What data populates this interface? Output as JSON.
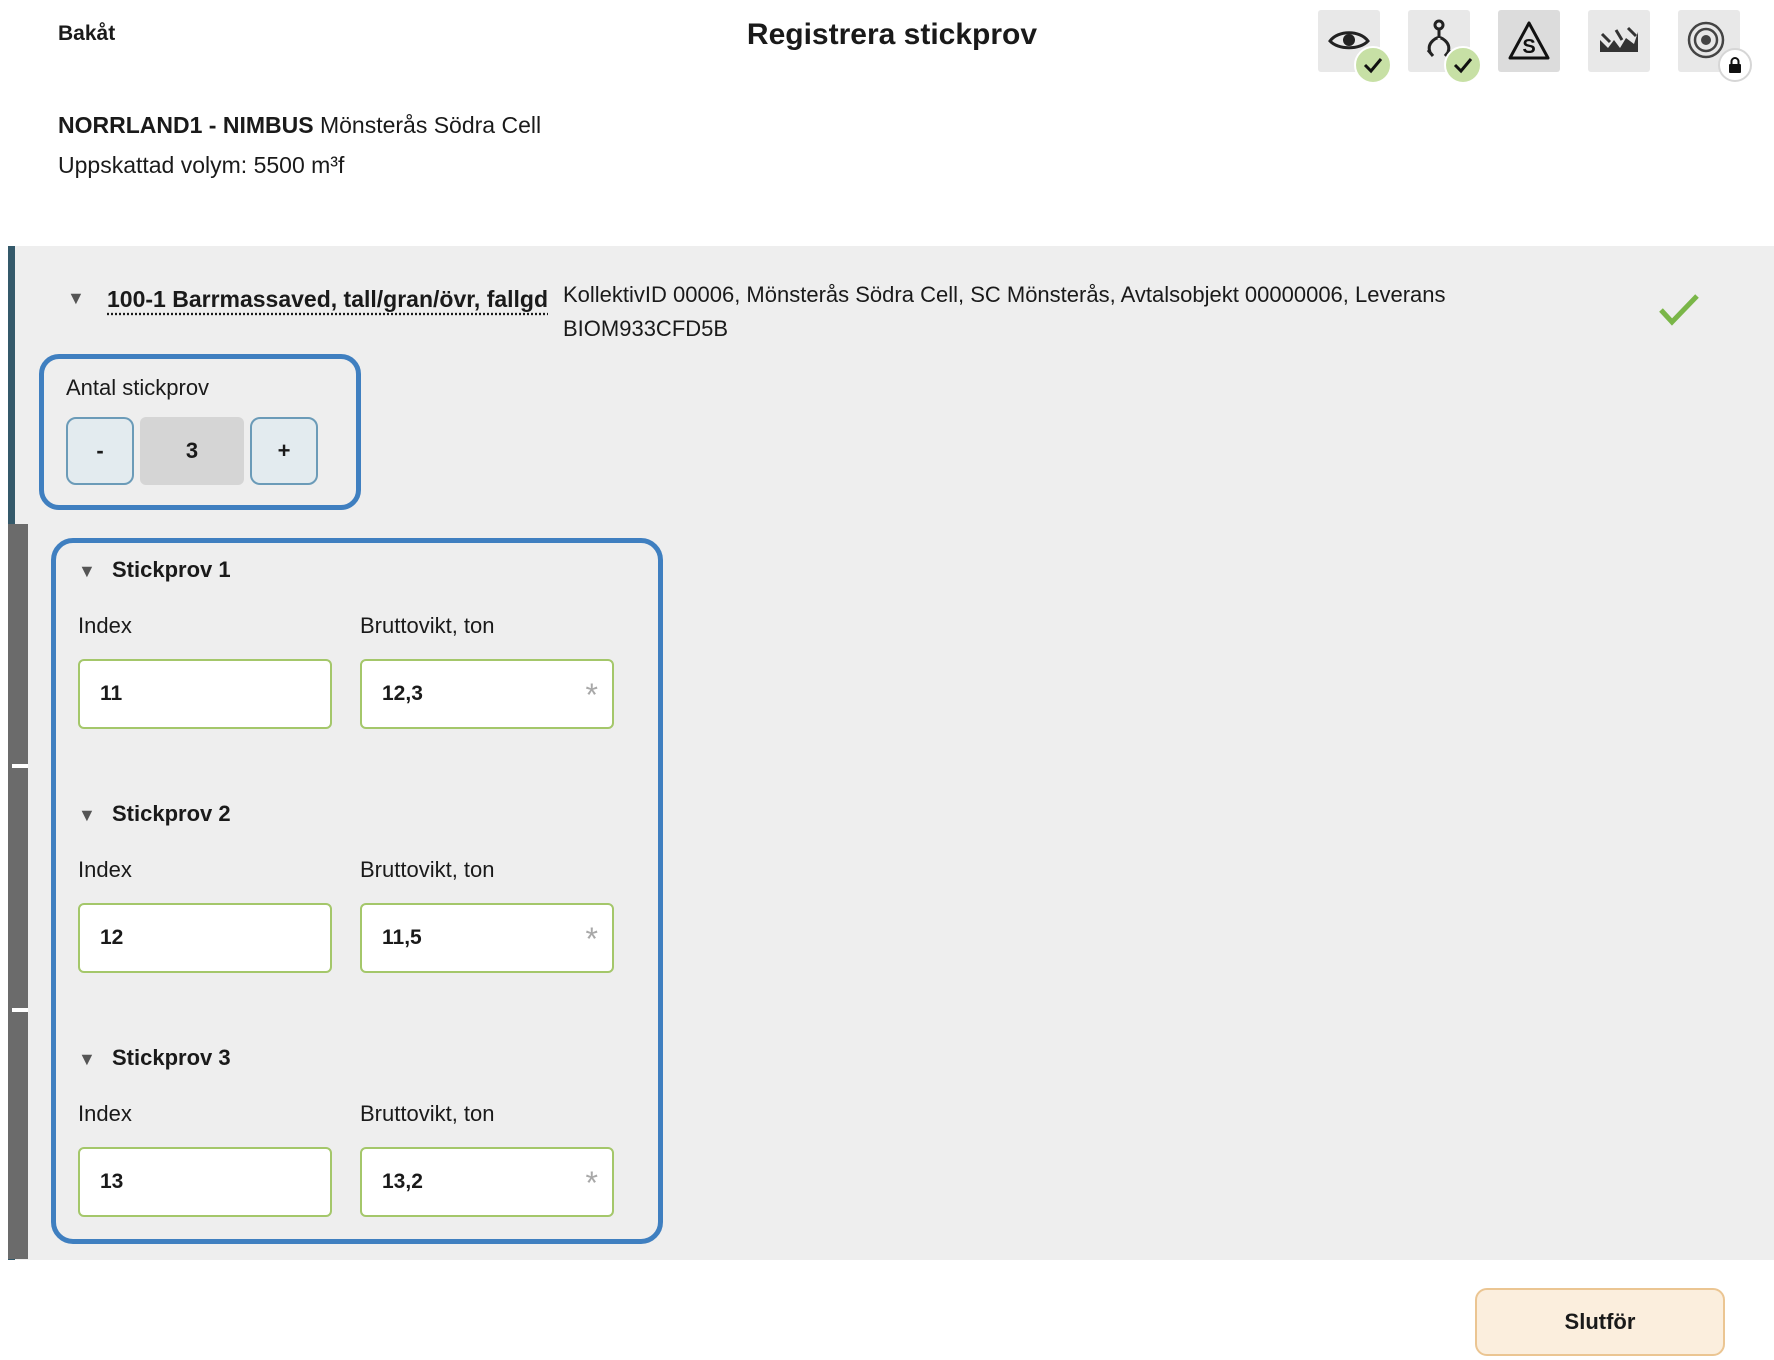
{
  "header": {
    "back_label": "Bakåt",
    "title": "Registrera stickprov"
  },
  "toolbar": {
    "tools": [
      {
        "icon": "eye-icon",
        "badge": "check-icon",
        "state": "done"
      },
      {
        "icon": "crane-grapple-icon",
        "badge": "check-icon",
        "state": "done"
      },
      {
        "icon": "sample-triangle-icon",
        "badge": null,
        "state": "active"
      },
      {
        "icon": "timber-truck-icon",
        "badge": null,
        "state": "idle"
      },
      {
        "icon": "wood-cross-section-icon",
        "badge": "lock-icon",
        "state": "locked"
      }
    ]
  },
  "order": {
    "code": "NORRLAND1 - NIMBUS",
    "customer": "Mönsterås Södra Cell",
    "volume": "Uppskattad volym: 5500 m³f"
  },
  "assortment": {
    "name": "100-1 Barrmassaved, tall/gran/övr, fallgd",
    "info_line1": "KollektivID 00006, Mönsterås Södra Cell, SC Mönsterås, Avtalsobjekt 00000006, Leverans",
    "info_line2": "BIOM933CFD5B",
    "status_icon": "check-icon",
    "status_color": "#7ab648"
  },
  "sample_count": {
    "label": "Antal stickprov",
    "minus_label": "-",
    "value": "3",
    "plus_label": "+"
  },
  "samples": [
    {
      "title": "Stickprov 1",
      "index_label": "Index",
      "index_value": "11",
      "weight_label": "Bruttovikt, ton",
      "weight_value": "12,3"
    },
    {
      "title": "Stickprov 2",
      "index_label": "Index",
      "index_value": "12",
      "weight_label": "Bruttovikt, ton",
      "weight_value": "11,5"
    },
    {
      "title": "Stickprov 3",
      "index_label": "Index",
      "index_value": "13",
      "weight_label": "Bruttovikt, ton",
      "weight_value": "13,2"
    }
  ],
  "required_marker": "*",
  "finish_label": "Slutför",
  "colors": {
    "accent_border": "#3f7fc0",
    "field_border": "#a4c76a",
    "finish_bg": "#fbeedd",
    "panel_bar": "#34596a"
  }
}
